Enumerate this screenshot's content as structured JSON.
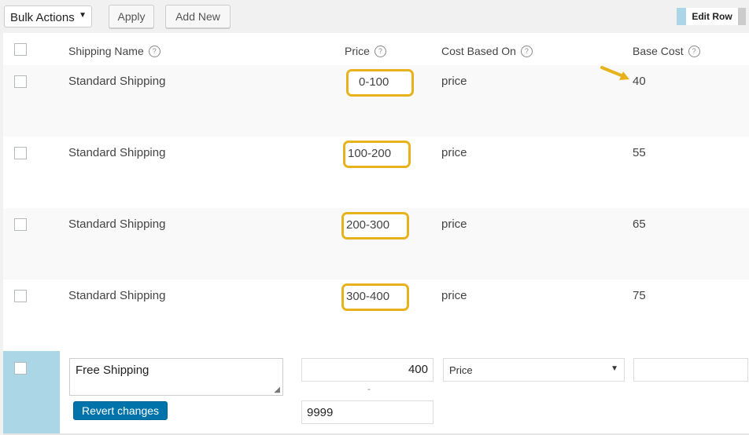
{
  "toolbar": {
    "bulk_actions": "Bulk Actions",
    "apply": "Apply",
    "add_new": "Add New",
    "edit_row": "Edit Row"
  },
  "columns": {
    "shipping_name": "Shipping Name",
    "price": "Price",
    "cost_based_on": "Cost Based On",
    "base_cost": "Base Cost"
  },
  "rows": [
    {
      "name": "Standard Shipping",
      "price": "0-100",
      "cost_based_on": "price",
      "base_cost": "40"
    },
    {
      "name": "Standard Shipping",
      "price": "100-200",
      "cost_based_on": "price",
      "base_cost": "55"
    },
    {
      "name": "Standard Shipping",
      "price": "200-300",
      "cost_based_on": "price",
      "base_cost": "65"
    },
    {
      "name": "Standard Shipping",
      "price": "300-400",
      "cost_based_on": "price",
      "base_cost": "75"
    }
  ],
  "edit_row": {
    "name": "Free Shipping",
    "price_min": "400",
    "separator": "-",
    "price_max": "9999",
    "cost_based_on": "Price",
    "base_cost": "",
    "revert": "Revert changes"
  },
  "colors": {
    "highlight": "#e8b21c",
    "edit_accent": "#abd6e6",
    "primary_button": "#0073aa"
  }
}
